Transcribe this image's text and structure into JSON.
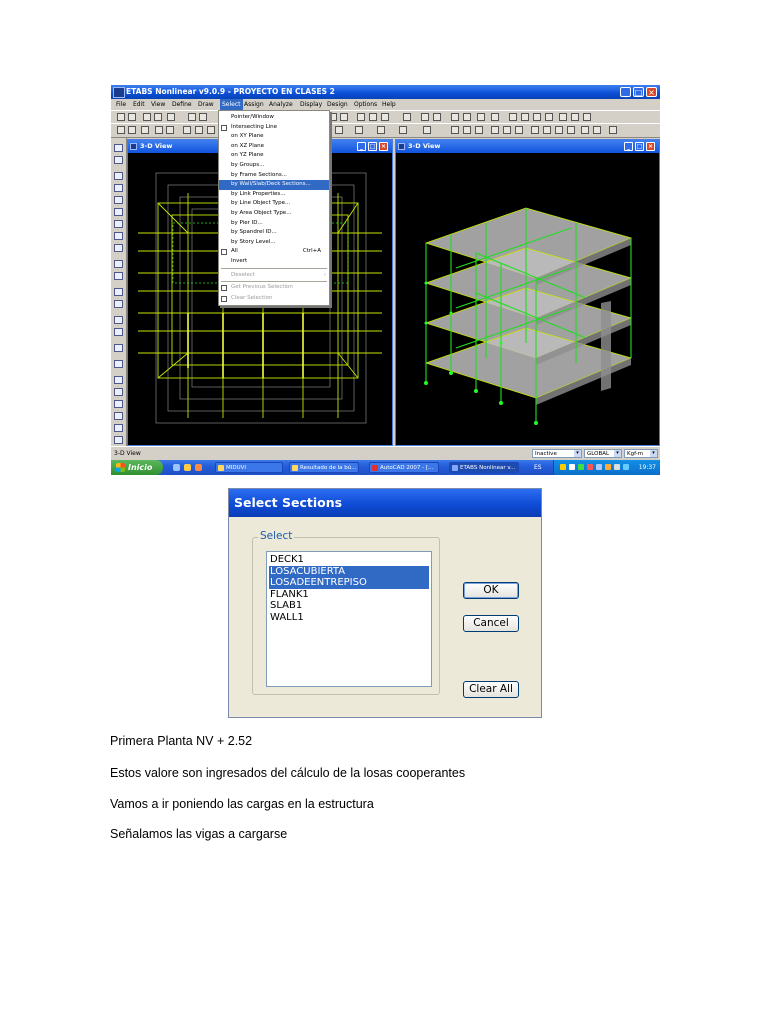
{
  "screenshot": {
    "window_title": "ETABS Nonlinear v9.0.9 - PROYECTO EN CLASES 2",
    "menus": [
      "File",
      "Edit",
      "View",
      "Define",
      "Draw",
      "Select",
      "Assign",
      "Analyze",
      "Display",
      "Design",
      "Options",
      "Help"
    ],
    "select_menu": [
      {
        "label": "Pointer/Window",
        "shortcut": ""
      },
      {
        "label": "Intersecting Line",
        "shortcut": ""
      },
      {
        "label": "on XY Plane",
        "shortcut": ""
      },
      {
        "label": "on XZ Plane",
        "shortcut": ""
      },
      {
        "label": "on YZ Plane",
        "shortcut": ""
      },
      {
        "label": "by Groups...",
        "shortcut": ""
      },
      {
        "label": "by Frame Sections...",
        "shortcut": ""
      },
      {
        "label": "by Wall/Slab/Deck Sections...",
        "shortcut": ""
      },
      {
        "label": "by Link Properties...",
        "shortcut": ""
      },
      {
        "label": "by Line Object Type...",
        "shortcut": ""
      },
      {
        "label": "by Area Object Type...",
        "shortcut": ""
      },
      {
        "label": "by Pier ID...",
        "shortcut": ""
      },
      {
        "label": "by Spandrel ID...",
        "shortcut": ""
      },
      {
        "label": "by Story Level...",
        "shortcut": ""
      },
      {
        "label": "All",
        "shortcut": "Ctrl+A"
      },
      {
        "label": "Invert",
        "shortcut": ""
      },
      {
        "label": "Deselect",
        "shortcut": ""
      },
      {
        "label": "Get Previous Selection",
        "shortcut": ""
      },
      {
        "label": "Clear Selection",
        "shortcut": ""
      }
    ],
    "left_view_title": "3-D View",
    "right_view_title": "3-D View",
    "status_text": "3-D View",
    "status_combos": [
      "Inactive",
      "GLOBAL",
      "Kgf-m"
    ],
    "taskbar": {
      "start_label": "Inicio",
      "tasks": [
        "MIDUVI",
        "Resultado de la bú...",
        "AutoCAD 2007 - [...",
        "ETABS Nonlinear v..."
      ],
      "language": "ES",
      "clock": "19:37"
    },
    "colors": {
      "wire": "#c8e600",
      "mesh": "#22dd22",
      "slab": "#c8c8c8",
      "highlight": "#316ac5"
    }
  },
  "dialog": {
    "title": "Select Sections",
    "group_label": "Select",
    "items": [
      {
        "label": "DECK1",
        "selected": false
      },
      {
        "label": "LOSACUBIERTA",
        "selected": true
      },
      {
        "label": "LOSADEENTREPISO",
        "selected": true
      },
      {
        "label": "FLANK1",
        "selected": false
      },
      {
        "label": "SLAB1",
        "selected": false
      },
      {
        "label": "WALL1",
        "selected": false
      }
    ],
    "ok_label": "OK",
    "cancel_label": "Cancel",
    "clear_label": "Clear All"
  },
  "text": {
    "p1": "Primera Planta NV + 2.52",
    "p2": "Estos valore son ingresados del cálculo de la losas cooperantes",
    "p3": "Vamos a ir poniendo las cargas en la estructura",
    "p4": "Señalamos las vigas a cargarse"
  }
}
